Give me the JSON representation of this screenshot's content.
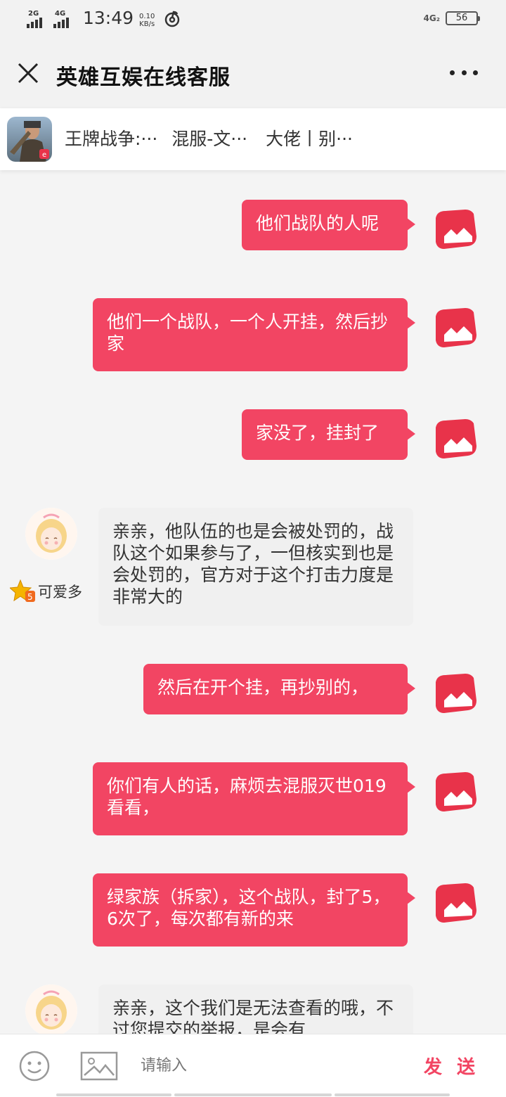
{
  "status_bar": {
    "signal1": "2G",
    "signal2": "4G",
    "time": "13:49",
    "speed_value": "0.10",
    "speed_unit": "KB/s",
    "network_right": "4G₂",
    "battery": "56"
  },
  "header": {
    "title": "英雄互娱在线客服",
    "close_icon": "close-icon",
    "more_icon": "more-icon"
  },
  "game_bar": {
    "game": "王牌战争:···",
    "server": "混服-文···",
    "role": "大佬丨别···"
  },
  "messages": [
    {
      "side": "out",
      "text": "他们战队的人呢"
    },
    {
      "side": "out",
      "text": "他们一个战队，一个人开挂，然后抄家"
    },
    {
      "side": "out",
      "text": "家没了，挂封了"
    },
    {
      "side": "in",
      "agent": "可爱多",
      "text": "亲亲，他队伍的也是会被处罚的，战队这个如果参与了，一但核实到也是会处罚的，官方对于这个打击力度是非常大的"
    },
    {
      "side": "out",
      "text": "然后在开个挂，再抄别的，"
    },
    {
      "side": "out",
      "text": "你们有人的话，麻烦去混服灭世019看看，"
    },
    {
      "side": "out",
      "text": "绿家族（拆家），这个战队，封了5，6次了，每次都有新的来"
    },
    {
      "side": "in",
      "agent": "",
      "text": "亲亲，这个我们是无法查看的哦，不过您提交的举报，是会有"
    }
  ],
  "input_bar": {
    "placeholder": "请输入",
    "send_label": "发 送",
    "emoji_icon": "emoji-icon",
    "image_icon": "image-icon"
  },
  "colors": {
    "accent": "#f24563",
    "incoming_bubble": "#f0f0f0"
  }
}
